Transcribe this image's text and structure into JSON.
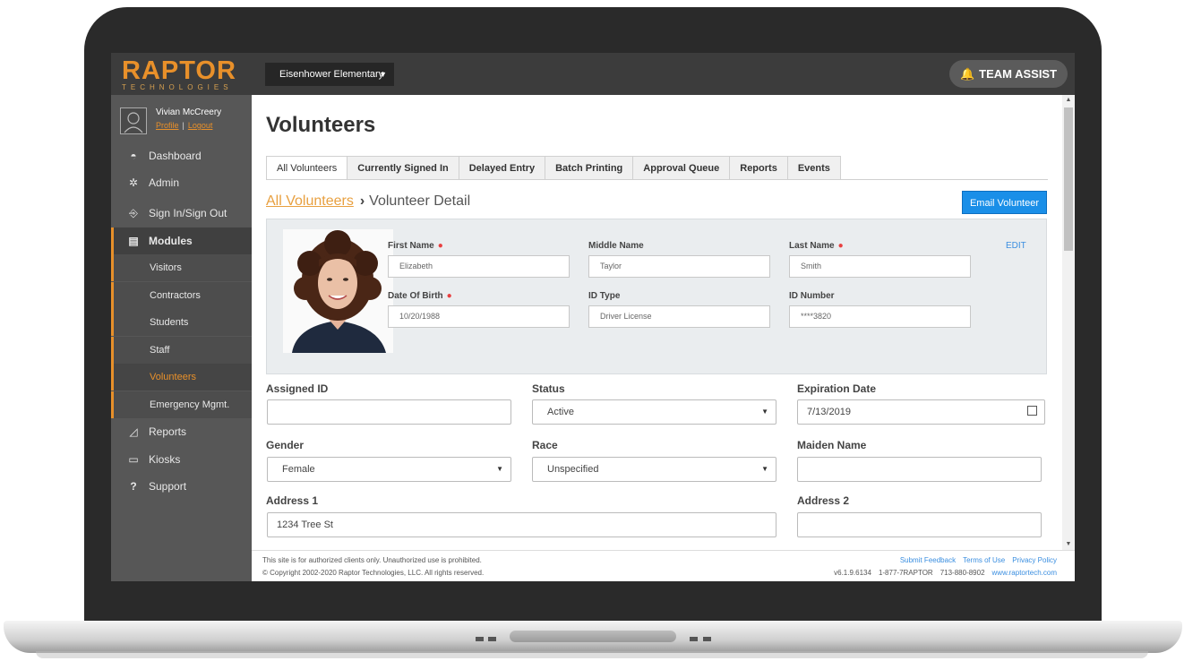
{
  "topbar": {
    "logo": "RAPTOR",
    "logo_sub": "TECHNOLOGIES",
    "school": "Eisenhower Elementary",
    "team_assist": "TEAM ASSIST"
  },
  "user": {
    "name": "Vivian McCreery",
    "profile": "Profile",
    "logout": "Logout"
  },
  "sidebar": {
    "dashboard": "Dashboard",
    "admin": "Admin",
    "signin": "Sign In/Sign Out",
    "modules": "Modules",
    "sub": [
      "Visitors",
      "Contractors",
      "Students",
      "Staff",
      "Volunteers",
      "Emergency Mgmt."
    ],
    "reports": "Reports",
    "kiosks": "Kiosks",
    "support": "Support"
  },
  "page": {
    "title": "Volunteers"
  },
  "tabs": [
    "All Volunteers",
    "Currently Signed In",
    "Delayed Entry",
    "Batch Printing",
    "Approval Queue",
    "Reports",
    "Events"
  ],
  "breadcrumb": {
    "link": "All Volunteers",
    "sep": "›",
    "current": "Volunteer Detail"
  },
  "email_button": "Email Volunteer",
  "card": {
    "first_name_label": "First Name",
    "first_name": "Elizabeth",
    "middle_name_label": "Middle Name",
    "middle_name": "Taylor",
    "last_name_label": "Last Name",
    "last_name": "Smith",
    "dob_label": "Date Of Birth",
    "dob": "10/20/1988",
    "id_type_label": "ID Type",
    "id_type": "Driver License",
    "id_number_label": "ID Number",
    "id_number": "****3820",
    "edit": "EDIT"
  },
  "form": {
    "assigned_id_label": "Assigned ID",
    "assigned_id": "",
    "status_label": "Status",
    "status": "Active",
    "expiration_label": "Expiration Date",
    "expiration": "7/13/2019",
    "gender_label": "Gender",
    "gender": "Female",
    "race_label": "Race",
    "race": "Unspecified",
    "maiden_label": "Maiden Name",
    "maiden": "",
    "address1_label": "Address 1",
    "address1": "1234 Tree St",
    "address2_label": "Address 2",
    "address2": ""
  },
  "footer": {
    "notice": "This site is for authorized clients only. Unauthorized use is prohibited.",
    "copyright": "© Copyright 2002-2020 Raptor Technologies, LLC. All rights reserved.",
    "submit_feedback": "Submit Feedback",
    "terms": "Terms of Use",
    "privacy": "Privacy Policy",
    "version": "v6.1.9.6134",
    "phone1": "1-877-7RAPTOR",
    "phone2": "713-880-8902",
    "website": "www.raptortech.com"
  },
  "colors": {
    "accent": "#e8902a",
    "primary_button": "#1a8fe8",
    "sidebar": "#575757",
    "topbar": "#3c3c3c"
  }
}
